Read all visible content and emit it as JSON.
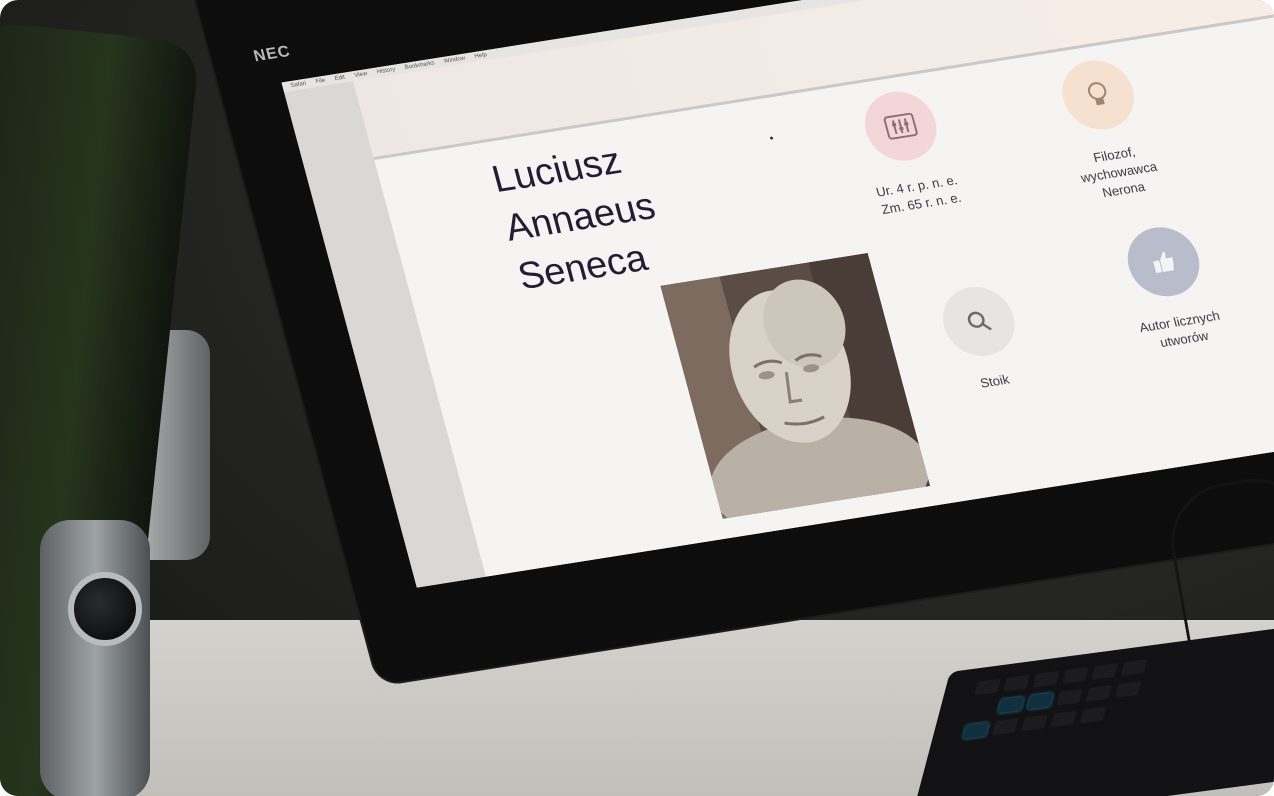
{
  "monitor": {
    "brand": "NEC"
  },
  "window": {
    "menu_items": [
      "Safari",
      "File",
      "Edit",
      "View",
      "History",
      "Bookmarks",
      "Window",
      "Help"
    ]
  },
  "page": {
    "title_lines": [
      "Luciusz",
      "Annaeus",
      "Seneca"
    ],
    "portrait_icon": "seneca-bust-photo"
  },
  "info": {
    "born": {
      "line1": "Ur. 4 r. p. n. e.",
      "line2": "Zm. 65 r. n. e.",
      "icon": "sliders-icon",
      "color": "#f3d6d8"
    },
    "role": {
      "line1": "Filozof,",
      "line2": "wychowawca",
      "line3": "Nerona",
      "icon": "lightbulb-icon",
      "color": "#f6e1d1"
    },
    "school": {
      "line1": "Stoik",
      "icon": "search-icon",
      "color": "#e6e5e4"
    },
    "works": {
      "line1": "Autor licznych",
      "line2": "utworów",
      "icon": "thumbs-up-icon",
      "color": "#b9bccb"
    }
  }
}
